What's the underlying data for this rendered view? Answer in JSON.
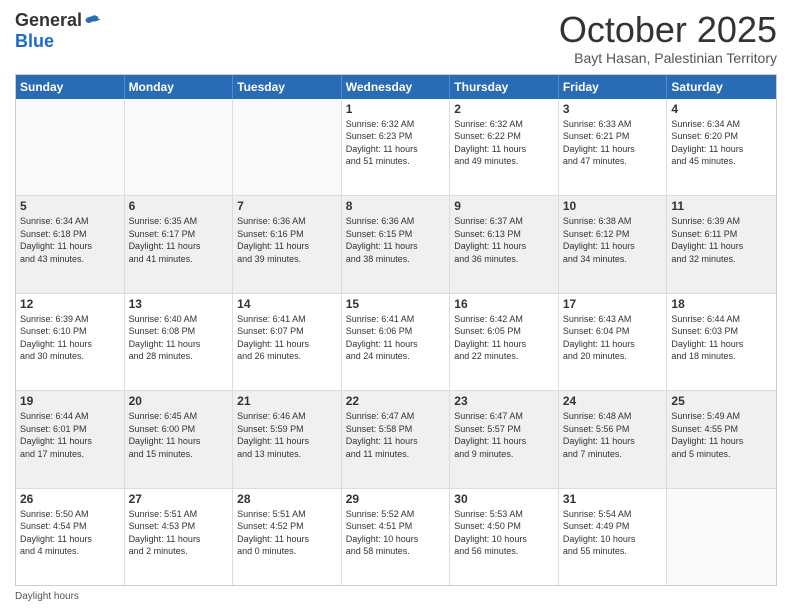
{
  "logo": {
    "general": "General",
    "blue": "Blue"
  },
  "title": "October 2025",
  "location": "Bayt Hasan, Palestinian Territory",
  "weekdays": [
    "Sunday",
    "Monday",
    "Tuesday",
    "Wednesday",
    "Thursday",
    "Friday",
    "Saturday"
  ],
  "footer": {
    "daylight_label": "Daylight hours"
  },
  "rows": [
    [
      {
        "day": "",
        "info": "",
        "empty": true
      },
      {
        "day": "",
        "info": "",
        "empty": true
      },
      {
        "day": "",
        "info": "",
        "empty": true
      },
      {
        "day": "1",
        "info": "Sunrise: 6:32 AM\nSunset: 6:23 PM\nDaylight: 11 hours\nand 51 minutes."
      },
      {
        "day": "2",
        "info": "Sunrise: 6:32 AM\nSunset: 6:22 PM\nDaylight: 11 hours\nand 49 minutes."
      },
      {
        "day": "3",
        "info": "Sunrise: 6:33 AM\nSunset: 6:21 PM\nDaylight: 11 hours\nand 47 minutes."
      },
      {
        "day": "4",
        "info": "Sunrise: 6:34 AM\nSunset: 6:20 PM\nDaylight: 11 hours\nand 45 minutes."
      }
    ],
    [
      {
        "day": "5",
        "info": "Sunrise: 6:34 AM\nSunset: 6:18 PM\nDaylight: 11 hours\nand 43 minutes.",
        "shaded": true
      },
      {
        "day": "6",
        "info": "Sunrise: 6:35 AM\nSunset: 6:17 PM\nDaylight: 11 hours\nand 41 minutes.",
        "shaded": true
      },
      {
        "day": "7",
        "info": "Sunrise: 6:36 AM\nSunset: 6:16 PM\nDaylight: 11 hours\nand 39 minutes.",
        "shaded": true
      },
      {
        "day": "8",
        "info": "Sunrise: 6:36 AM\nSunset: 6:15 PM\nDaylight: 11 hours\nand 38 minutes.",
        "shaded": true
      },
      {
        "day": "9",
        "info": "Sunrise: 6:37 AM\nSunset: 6:13 PM\nDaylight: 11 hours\nand 36 minutes.",
        "shaded": true
      },
      {
        "day": "10",
        "info": "Sunrise: 6:38 AM\nSunset: 6:12 PM\nDaylight: 11 hours\nand 34 minutes.",
        "shaded": true
      },
      {
        "day": "11",
        "info": "Sunrise: 6:39 AM\nSunset: 6:11 PM\nDaylight: 11 hours\nand 32 minutes.",
        "shaded": true
      }
    ],
    [
      {
        "day": "12",
        "info": "Sunrise: 6:39 AM\nSunset: 6:10 PM\nDaylight: 11 hours\nand 30 minutes."
      },
      {
        "day": "13",
        "info": "Sunrise: 6:40 AM\nSunset: 6:08 PM\nDaylight: 11 hours\nand 28 minutes."
      },
      {
        "day": "14",
        "info": "Sunrise: 6:41 AM\nSunset: 6:07 PM\nDaylight: 11 hours\nand 26 minutes."
      },
      {
        "day": "15",
        "info": "Sunrise: 6:41 AM\nSunset: 6:06 PM\nDaylight: 11 hours\nand 24 minutes."
      },
      {
        "day": "16",
        "info": "Sunrise: 6:42 AM\nSunset: 6:05 PM\nDaylight: 11 hours\nand 22 minutes."
      },
      {
        "day": "17",
        "info": "Sunrise: 6:43 AM\nSunset: 6:04 PM\nDaylight: 11 hours\nand 20 minutes."
      },
      {
        "day": "18",
        "info": "Sunrise: 6:44 AM\nSunset: 6:03 PM\nDaylight: 11 hours\nand 18 minutes."
      }
    ],
    [
      {
        "day": "19",
        "info": "Sunrise: 6:44 AM\nSunset: 6:01 PM\nDaylight: 11 hours\nand 17 minutes.",
        "shaded": true
      },
      {
        "day": "20",
        "info": "Sunrise: 6:45 AM\nSunset: 6:00 PM\nDaylight: 11 hours\nand 15 minutes.",
        "shaded": true
      },
      {
        "day": "21",
        "info": "Sunrise: 6:46 AM\nSunset: 5:59 PM\nDaylight: 11 hours\nand 13 minutes.",
        "shaded": true
      },
      {
        "day": "22",
        "info": "Sunrise: 6:47 AM\nSunset: 5:58 PM\nDaylight: 11 hours\nand 11 minutes.",
        "shaded": true
      },
      {
        "day": "23",
        "info": "Sunrise: 6:47 AM\nSunset: 5:57 PM\nDaylight: 11 hours\nand 9 minutes.",
        "shaded": true
      },
      {
        "day": "24",
        "info": "Sunrise: 6:48 AM\nSunset: 5:56 PM\nDaylight: 11 hours\nand 7 minutes.",
        "shaded": true
      },
      {
        "day": "25",
        "info": "Sunrise: 5:49 AM\nSunset: 4:55 PM\nDaylight: 11 hours\nand 5 minutes.",
        "shaded": true
      }
    ],
    [
      {
        "day": "26",
        "info": "Sunrise: 5:50 AM\nSunset: 4:54 PM\nDaylight: 11 hours\nand 4 minutes."
      },
      {
        "day": "27",
        "info": "Sunrise: 5:51 AM\nSunset: 4:53 PM\nDaylight: 11 hours\nand 2 minutes."
      },
      {
        "day": "28",
        "info": "Sunrise: 5:51 AM\nSunset: 4:52 PM\nDaylight: 11 hours\nand 0 minutes."
      },
      {
        "day": "29",
        "info": "Sunrise: 5:52 AM\nSunset: 4:51 PM\nDaylight: 10 hours\nand 58 minutes."
      },
      {
        "day": "30",
        "info": "Sunrise: 5:53 AM\nSunset: 4:50 PM\nDaylight: 10 hours\nand 56 minutes."
      },
      {
        "day": "31",
        "info": "Sunrise: 5:54 AM\nSunset: 4:49 PM\nDaylight: 10 hours\nand 55 minutes."
      },
      {
        "day": "",
        "info": "",
        "empty": true
      }
    ]
  ]
}
